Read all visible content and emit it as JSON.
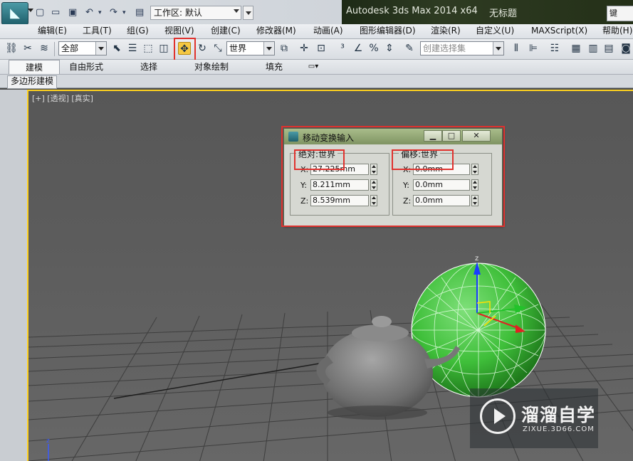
{
  "titlebar": {
    "app_title": "Autodesk 3ds Max  2014 x64",
    "doc_title": "无标题",
    "workspace_label": "工作区: 默认",
    "search_text": "键"
  },
  "menubar": {
    "items": [
      "编辑(E)",
      "工具(T)",
      "组(G)",
      "视图(V)",
      "创建(C)",
      "修改器(M)",
      "动画(A)",
      "图形编辑器(D)",
      "渲染(R)",
      "自定义(U)",
      "MAXScript(X)",
      "帮助(H)"
    ]
  },
  "toolbar": {
    "selection_filter": "全部",
    "reference_coord": "世界",
    "named_selection_placeholder": "创建选择集"
  },
  "ribbon": {
    "tabs": [
      "建模",
      "自由形式",
      "选择",
      "对象绘制",
      "填充"
    ],
    "active_tab": "建模",
    "panel_label": "多边形建模"
  },
  "viewport": {
    "label": "[+] [透视] [真实]",
    "gizmo_z_label": "z"
  },
  "dialog": {
    "title": "移动变换输入",
    "absolute": {
      "title": "绝对:世界",
      "x_label": "X:",
      "x_value": "27.225mm",
      "y_label": "Y:",
      "y_value": "8.211mm",
      "z_label": "Z:",
      "z_value": "8.539mm"
    },
    "offset": {
      "title": "偏移:世界",
      "x_label": "X:",
      "x_value": "0.0mm",
      "y_label": "Y:",
      "y_value": "0.0mm",
      "z_label": "Z:",
      "z_value": "0.0mm"
    }
  },
  "watermark": {
    "text": "溜溜自学",
    "url": "ZIXUE.3D66.COM"
  },
  "colors": {
    "highlight": "#e0322e",
    "viewport_border": "#ffd21e",
    "sphere": "#3fbf3a",
    "move_tool_active": "#f5c842"
  }
}
